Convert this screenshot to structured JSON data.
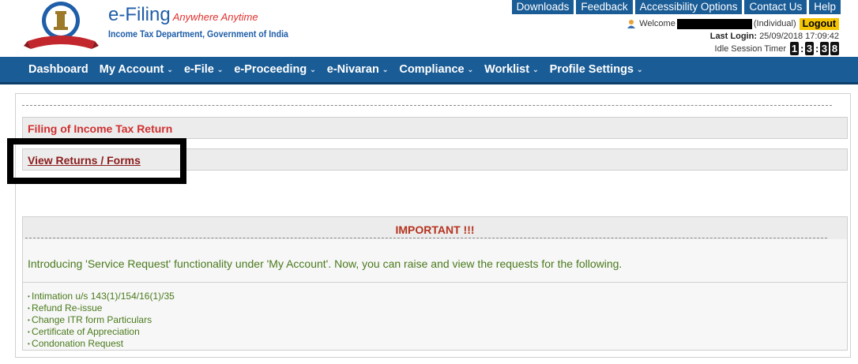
{
  "brand": {
    "title": "e-Filing",
    "tagline": "Anywhere Anytime",
    "subtitle": "Income Tax Department, Government of India"
  },
  "toplinks": [
    "Downloads",
    "Feedback",
    "Accessibility Options",
    "Contact Us",
    "Help"
  ],
  "user": {
    "welcome_label": "Welcome",
    "type": "(Individual)",
    "logout_label": "Logout",
    "last_login_label": "Last Login:",
    "last_login_value": "25/09/2018 17:09:42",
    "idle_label": "Idle Session Timer",
    "timer_digits": [
      "1",
      "3",
      "3",
      "8"
    ],
    "timer_sep": ":"
  },
  "nav": {
    "items": [
      "Dashboard",
      "My Account",
      "e-File",
      "e-Proceeding",
      "e-Nivaran",
      "Compliance",
      "Worklist",
      "Profile Settings"
    ],
    "caret": "⌄"
  },
  "main": {
    "filing_title": "Filing of Income Tax Return",
    "view_link": "View Returns / Forms"
  },
  "important": {
    "title": "IMPORTANT !!!",
    "text": "Introducing 'Service Request' functionality under 'My Account'. Now, you can raise and view the requests for the following.",
    "items": [
      "Intimation u/s 143(1)/154/16(1)/35",
      "Refund Re-issue",
      "Change ITR form Particulars",
      "Certificate of Appreciation",
      "Condonation Request"
    ]
  },
  "colors": {
    "nav_bg": "#1a5c96",
    "logout_bg": "#f4c400",
    "heading_red": "#d03030",
    "notice_green": "#4a7a1c"
  }
}
